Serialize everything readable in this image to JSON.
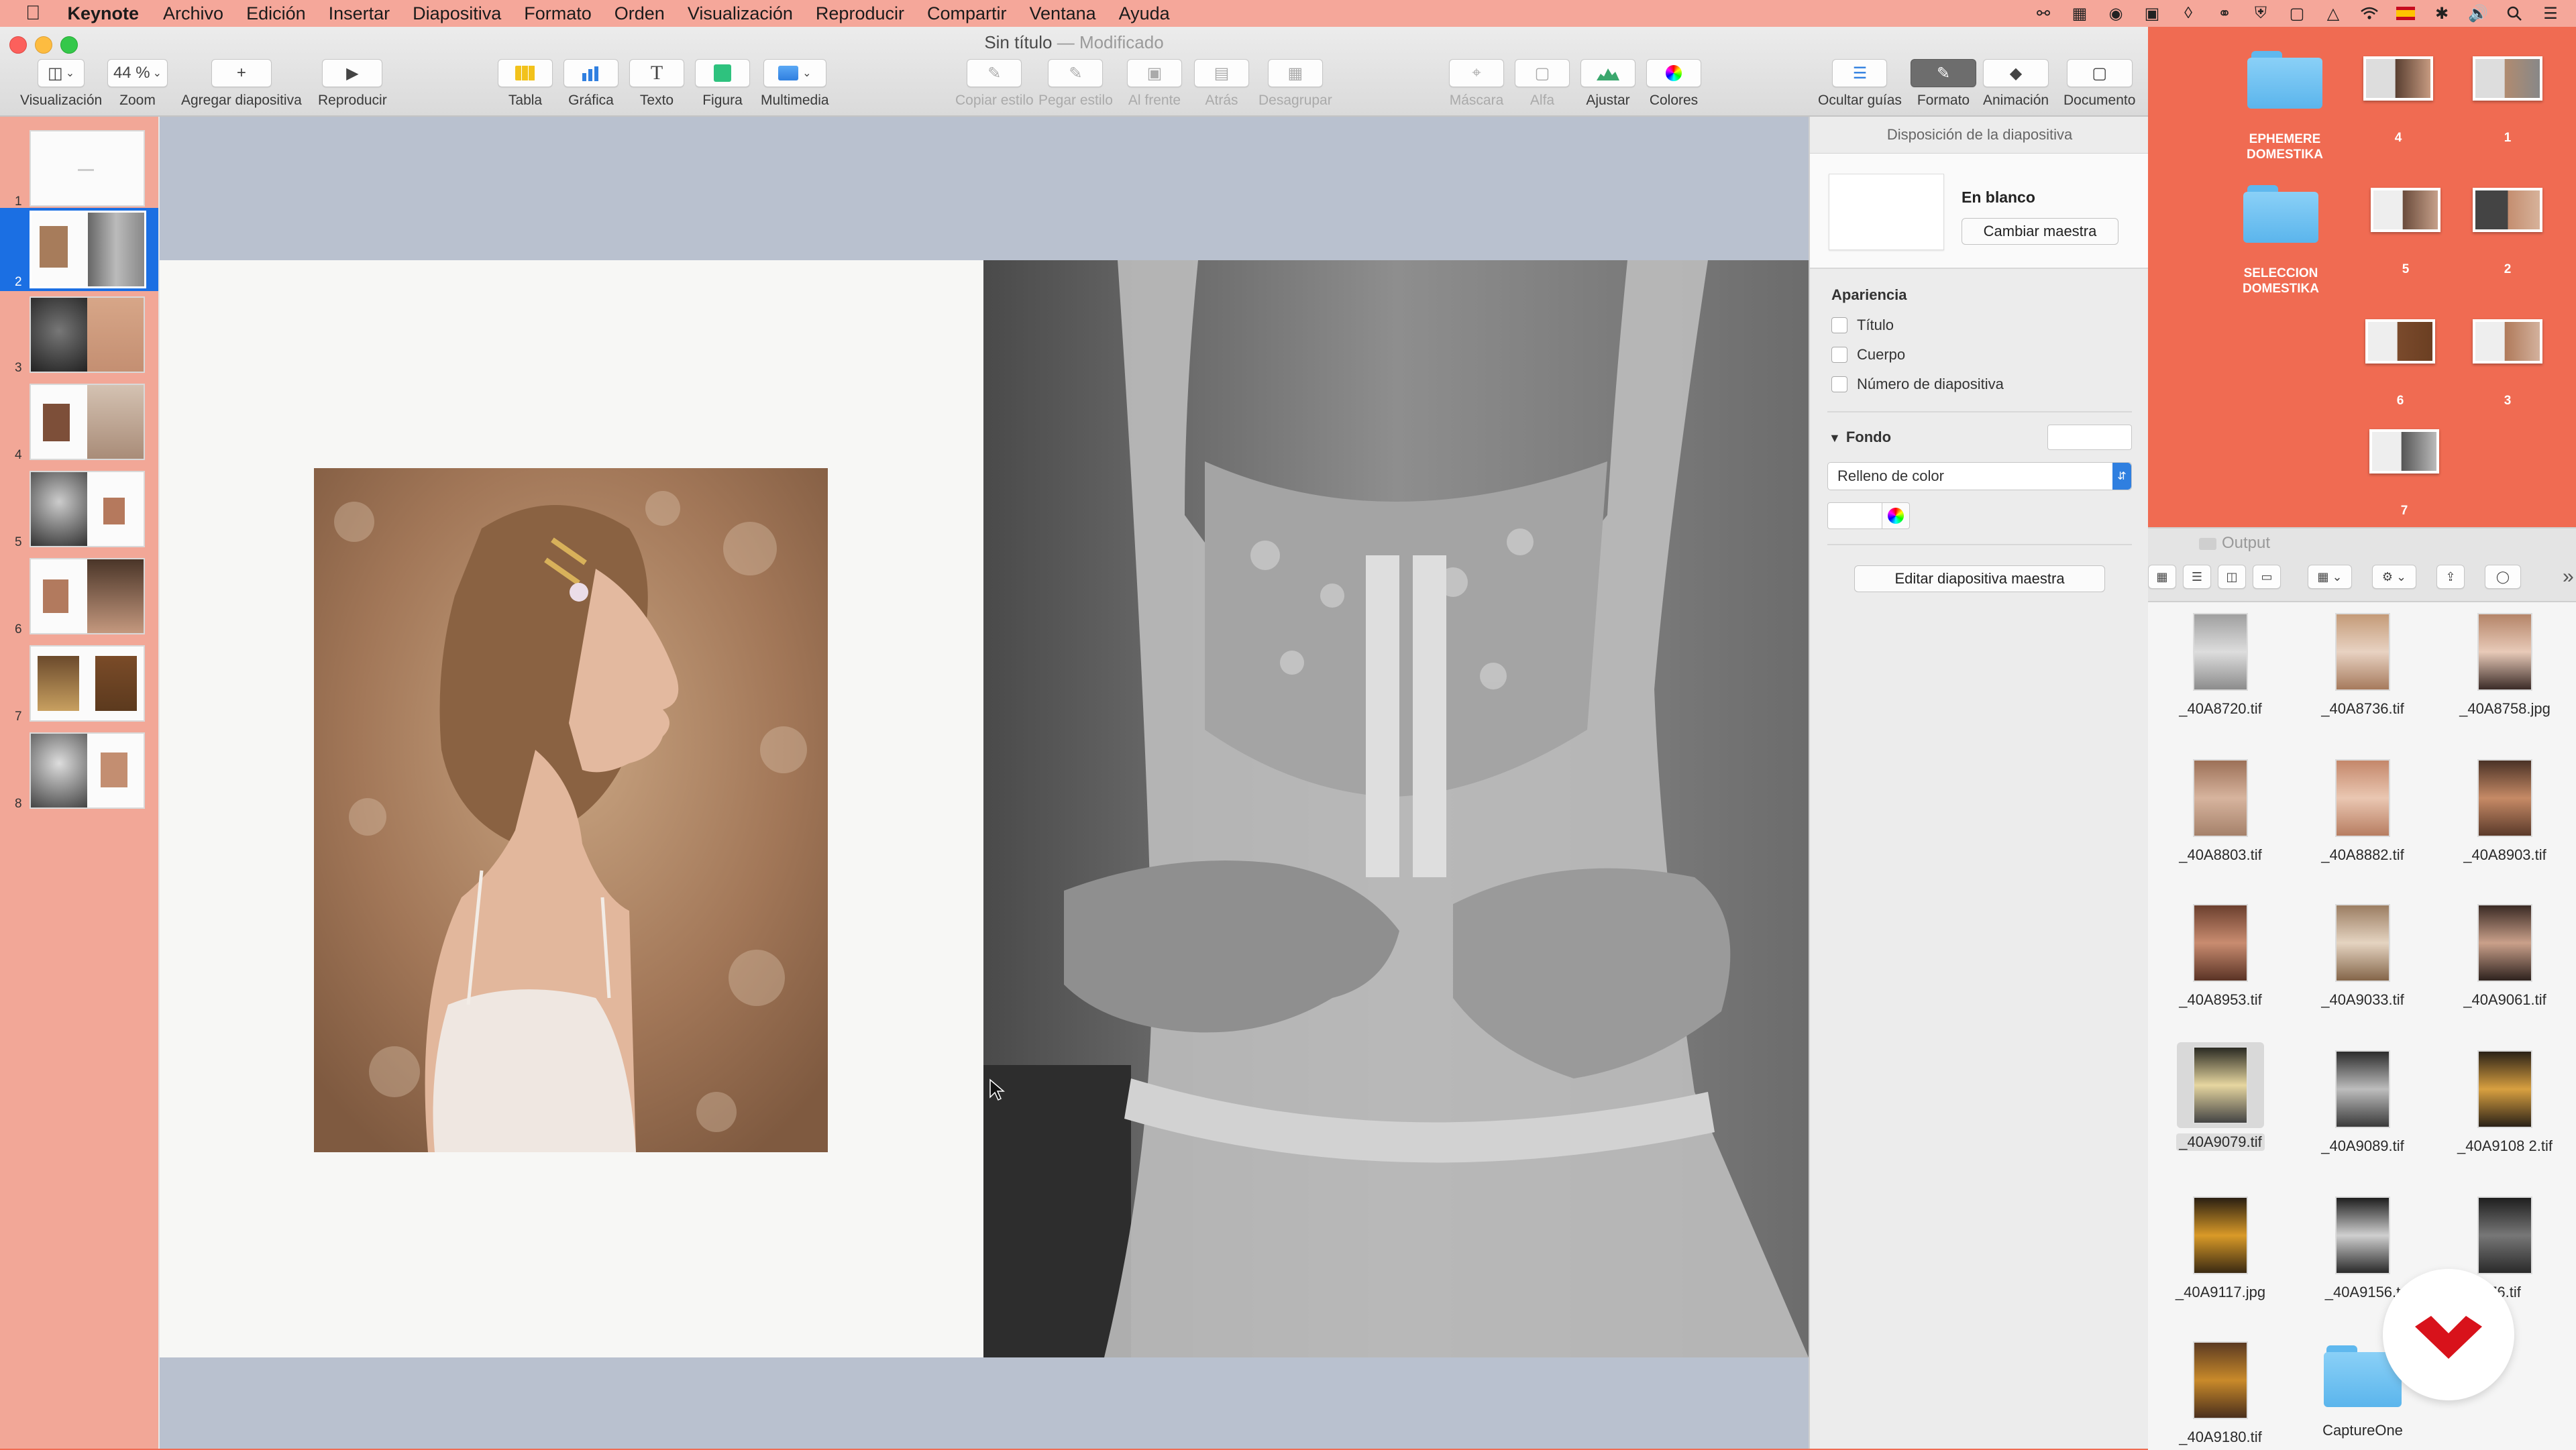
{
  "menubar": {
    "app_name": "Keynote",
    "items": [
      "Archivo",
      "Edición",
      "Insertar",
      "Diapositiva",
      "Formato",
      "Orden",
      "Visualización",
      "Reproducir",
      "Compartir",
      "Ventana",
      "Ayuda"
    ],
    "status_icons": [
      "creative-cloud-icon",
      "remote-icon",
      "cc-icon",
      "flipboard-icon",
      "dropbox-icon",
      "key-icon",
      "shield-icon",
      "cast-icon",
      "airplay-icon",
      "wifi-icon",
      "spain-flag-icon",
      "bluetooth-icon",
      "volume-icon",
      "spotlight-icon",
      "notification-center-icon"
    ]
  },
  "window": {
    "title": "Sin título",
    "separator": " — ",
    "status": "Modificado"
  },
  "toolbar": {
    "view_label": "Visualización",
    "zoom_value": "44 %",
    "zoom_label": "Zoom",
    "add_slide_label": "Agregar diapositiva",
    "play_label": "Reproducir",
    "table_label": "Tabla",
    "chart_label": "Gráfica",
    "text_label": "Texto",
    "shape_label": "Figura",
    "media_label": "Multimedia",
    "copy_style_label": "Copiar estilo",
    "paste_style_label": "Pegar estilo",
    "front_label": "Al frente",
    "back_label": "Atrás",
    "ungroup_label": "Desagrupar",
    "mask_label": "Máscara",
    "alpha_label": "Alfa",
    "adjust_label": "Ajustar",
    "colors_label": "Colores",
    "guides_label": "Ocultar guías",
    "format_label": "Formato",
    "animation_label": "Animación",
    "document_label": "Documento"
  },
  "navigator": {
    "slides": [
      "1",
      "2",
      "3",
      "4",
      "5",
      "6",
      "7",
      "8"
    ],
    "selected": 2
  },
  "inspector": {
    "header": "Disposición de la diapositiva",
    "layout_name": "En blanco",
    "change_master_button": "Cambiar maestra",
    "appearance_title": "Apariencia",
    "check_title": "Título",
    "check_body": "Cuerpo",
    "check_slide_number": "Número de diapositiva",
    "background_title": "Fondo",
    "fill_type": "Relleno de color",
    "edit_master_button": "Editar diapositiva maestra"
  },
  "desktop": {
    "folder1": "EPHEMERE DOMESTIKA",
    "folder2": "SELECCION DOMESTIKA",
    "thumbs": [
      "4",
      "1",
      "5",
      "2",
      "6",
      "3",
      "7"
    ]
  },
  "finder": {
    "title": "Output",
    "files": [
      "_40A8720.tif",
      "_40A8736.tif",
      "_40A8758.jpg",
      "_40A8803.tif",
      "_40A8882.tif",
      "_40A8903.tif",
      "_40A8953.tif",
      "_40A9033.tif",
      "_40A9061.tif",
      "_40A9079.tif",
      "_40A9089.tif",
      "_40A9108 2.tif",
      "_40A9117.jpg",
      "_40A9156.t",
      "76.tif",
      "_40A9180.tif",
      "CaptureOne"
    ]
  },
  "colors": {
    "desktop": "#f06b52",
    "selection": "#1b6fe3",
    "canvas": "#b9c1cf"
  }
}
